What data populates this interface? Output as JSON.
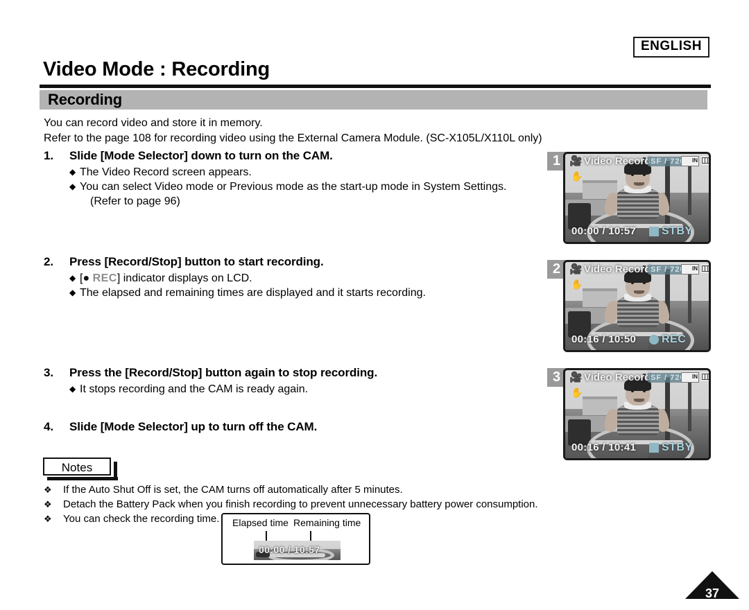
{
  "language_badge": "ENGLISH",
  "page_title": "Video Mode : Recording",
  "section_title": "Recording",
  "intro": {
    "line1": "You can record video and store it in memory.",
    "line2": "Refer to the page 108 for recording video using the External Camera Module. (SC-X105L/X110L only)"
  },
  "steps": [
    {
      "number": "1.",
      "heading": "Slide [Mode Selector] down to turn on the CAM.",
      "bullets": [
        "The Video Record screen appears.",
        "You can select Video mode or Previous mode as the start-up mode in System Settings."
      ],
      "subline": "(Refer to page 96)"
    },
    {
      "number": "2.",
      "heading": "Press [Record/Stop] button to start recording.",
      "bullet_rec_prefix": "[",
      "bullet_rec_token": "REC",
      "bullet_rec_suffix": "] indicator displays on LCD.",
      "bullets": [
        "The elapsed and remaining times are displayed and it starts recording."
      ]
    },
    {
      "number": "3.",
      "heading": "Press the [Record/Stop] button again to stop recording.",
      "bullets": [
        "It stops recording and the CAM is ready again."
      ]
    },
    {
      "number": "4.",
      "heading": "Slide [Mode Selector] up to turn off the CAM.",
      "bullets": []
    }
  ],
  "notes": {
    "label": "Notes",
    "items": [
      "If the Auto Shut Off is set, the CAM turns off automatically after 5 minutes.",
      "Detach the Battery Pack when you finish recording to prevent unnecessary battery power consumption.",
      "You can check the recording time."
    ]
  },
  "callout": {
    "elapsed_label": "Elapsed time",
    "remaining_label": "Remaining time",
    "lcd_time": "00:00 / 10:57"
  },
  "screenshots": [
    {
      "badge": "1",
      "mode_label": "Video Record",
      "quality": "SF  /  720",
      "memory": "IN",
      "time": "00:00 / 10:57",
      "status": "STBY",
      "status_icon": "square"
    },
    {
      "badge": "2",
      "mode_label": "Video Record",
      "quality": "SF  /  720",
      "memory": "IN",
      "time": "00:16 / 10:50",
      "status": "REC",
      "status_icon": "circle"
    },
    {
      "badge": "3",
      "mode_label": "Video Record",
      "quality": "SF  /  720",
      "memory": "IN",
      "time": "00:16 / 10:41",
      "status": "STBY",
      "status_icon": "square"
    }
  ],
  "page_number": "37",
  "colors": {
    "section_bar": "#b3b3b3",
    "rule": "#111111",
    "rec_token": "#8d8d8d",
    "lcd_status": "#a9d3e0",
    "badge": "#9a9a9a"
  }
}
